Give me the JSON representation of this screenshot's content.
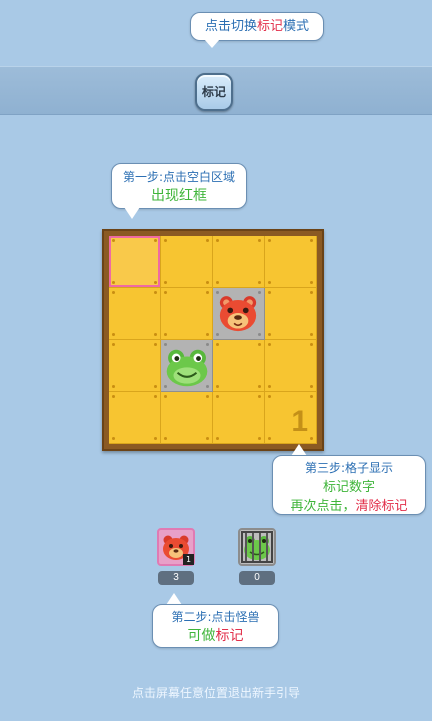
{
  "top_hint": {
    "prefix": "点击切换",
    "highlight": "标记",
    "suffix": "模式"
  },
  "toolbar": {
    "mark_label": "标记"
  },
  "step1": {
    "line1": "第一步:点击空白区域",
    "line2": "出现红框"
  },
  "step2": {
    "line1": "第二步:点击怪兽",
    "line2_prefix": "可做",
    "line2_highlight": "标记"
  },
  "step3": {
    "line1": "第三步:格子显示",
    "line2": "标记数字",
    "line3_prefix": "再次点击，",
    "line3_highlight": "清除标记"
  },
  "board": {
    "size": 4,
    "selected_cell": [
      0,
      0
    ],
    "grey_cells": [
      [
        1,
        2
      ],
      [
        2,
        1
      ]
    ],
    "marked_cell": {
      "row": 3,
      "col": 3,
      "number": "1"
    },
    "monsters": [
      {
        "name": "red-bear",
        "row": 1,
        "col": 2
      },
      {
        "name": "green-frog",
        "row": 2,
        "col": 1
      }
    ]
  },
  "monster_tray": [
    {
      "name": "red-bear",
      "badge": "1",
      "count": "3",
      "selected": true,
      "caged": false
    },
    {
      "name": "green-frog",
      "badge": "",
      "count": "0",
      "selected": false,
      "caged": true
    }
  ],
  "footer": {
    "exit_text": "点击屏幕任意位置退出新手引导"
  },
  "colors": {
    "background": "#a9c9e6",
    "tile": "#f7c531",
    "frame": "#8b5a23",
    "highlight_red": "#e2304b",
    "highlight_green": "#3fb53a",
    "selection": "#ef6aa3"
  }
}
